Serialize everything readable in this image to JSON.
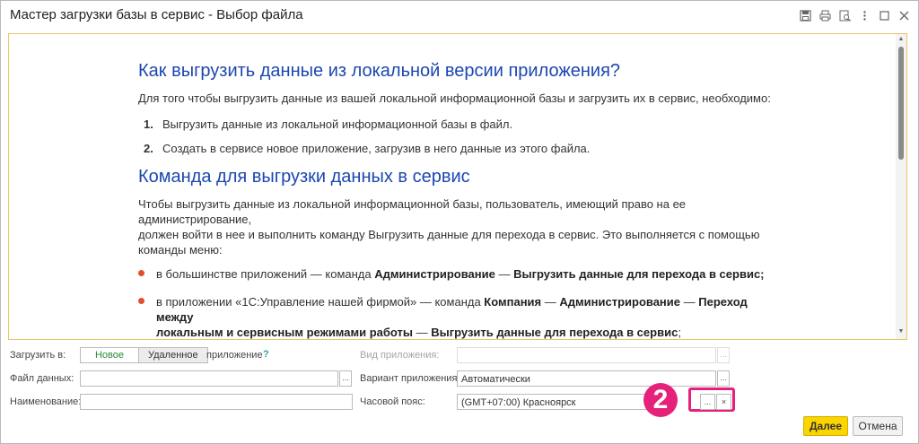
{
  "window": {
    "title": "Мастер загрузки базы в сервис - Выбор файла",
    "toolbar_icons": [
      "save-icon",
      "print-icon",
      "preview-icon",
      "more-icon",
      "maximize-icon",
      "close-icon"
    ]
  },
  "content": {
    "heading1": "Как выгрузить данные из локальной версии приложения?",
    "intro": "Для того чтобы выгрузить данные из вашей локальной информационной базы и загрузить их в сервис, необходимо:",
    "steps": [
      {
        "num": "1.",
        "text": "Выгрузить данные из локальной информационной базы в файл."
      },
      {
        "num": "2.",
        "text": "Создать в сервисе новое приложение, загрузив в него данные из этого файла."
      }
    ],
    "heading2": "Команда для выгрузки данных в сервис",
    "para_line1": "Чтобы выгрузить данные из локальной информационной базы, пользователь, имеющий право на ее",
    "para_line2": "администрирование,",
    "para_line3": "должен войти в нее и выполнить команду Выгрузить данные для перехода в сервис. Это выполняется с помощью",
    "para_line4": "команды меню:",
    "bullet1": {
      "pre": "в большинстве приложений — команда ",
      "b1": "Администрирование",
      "mid": " — ",
      "b2": "Выгрузить данные для перехода в сервис;"
    },
    "bullet2": {
      "pre": "в приложении «1С:Управление нашей фирмой» — команда ",
      "b1": "Компания",
      "sep1": " — ",
      "b2": "Администрирование",
      "sep2": " — ",
      "b3": "Переход",
      "b3b": "между",
      "b4": "локальным и сервисным режимами работы",
      "sep3": " — ",
      "b5": "Выгрузить данные для перехода в сервис",
      "end": ";"
    }
  },
  "form": {
    "load_to_label": "Загрузить в:",
    "load_new": "Новое",
    "load_remote": "Удаленное",
    "app_suffix": "приложение",
    "help": "?",
    "data_file_label": "Файл данных:",
    "data_file_value": "",
    "name_label": "Наименование:",
    "name_value": "",
    "app_kind_label": "Вид приложения:",
    "app_kind_value": "",
    "app_variant_label": "Вариант приложения:",
    "app_variant_value": "Автоматически",
    "timezone_label": "Часовой пояс:",
    "timezone_value": "(GMT+07:00) Красноярск",
    "dots": "...",
    "clear": "×",
    "badge": "2"
  },
  "buttons": {
    "next": "Далее",
    "cancel": "Отмена"
  },
  "colors": {
    "heading": "#1c47b0",
    "accent": "#e5217a",
    "primary_button": "#fcd400",
    "bullet": "#e0502a",
    "active_segment": "#2a8a3a"
  }
}
